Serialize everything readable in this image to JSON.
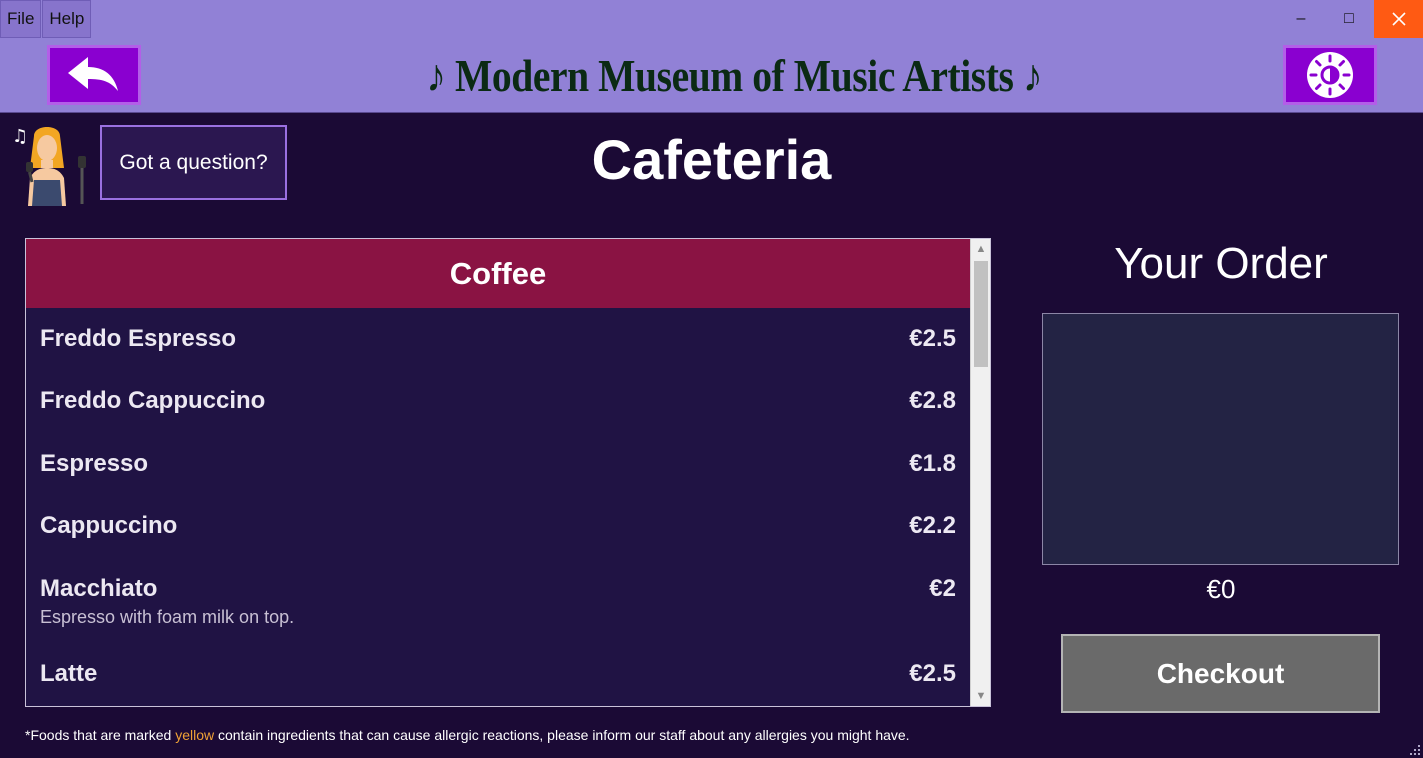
{
  "menu_bar": {
    "file": "File",
    "help": "Help"
  },
  "window_controls": {
    "minimize": "–",
    "maximize": "□",
    "close": "✕"
  },
  "header": {
    "title": "♪ Modern Museum of Music Artists ♪",
    "back_icon": "back-arrow-icon",
    "theme_icon": "sun-icon"
  },
  "assistant": {
    "icon": "singer-avatar-icon",
    "question_label": "Got a question?"
  },
  "page_title": "Cafeteria",
  "menu": {
    "category": "Coffee",
    "items": [
      {
        "name": "Freddo Espresso",
        "price": "€2.5",
        "description": ""
      },
      {
        "name": "Freddo Cappuccino",
        "price": "€2.8",
        "description": ""
      },
      {
        "name": "Espresso",
        "price": "€1.8",
        "description": ""
      },
      {
        "name": "Cappuccino",
        "price": "€2.2",
        "description": ""
      },
      {
        "name": "Macchiato",
        "price": "€2",
        "description": "Espresso with foam milk on top."
      },
      {
        "name": "Latte",
        "price": "€2.5",
        "description": ""
      }
    ]
  },
  "order": {
    "title": "Your Order",
    "total": "€0",
    "checkout_label": "Checkout"
  },
  "footnote": {
    "before": "*Foods that are marked ",
    "highlight": "yellow",
    "after": " contain ingredients that can cause allergic reactions, please inform our staff about any allergies you might have."
  },
  "colors": {
    "background": "#1b0a35",
    "title_bar": "#9181d6",
    "nav_button": "#8a00d0",
    "category_header": "#8a1343",
    "menu_panel": "#201344",
    "order_box": "#232344",
    "checkout_button": "#6a6a6a",
    "allergen_highlight": "#f0a236",
    "close_button": "#ff5a13"
  }
}
